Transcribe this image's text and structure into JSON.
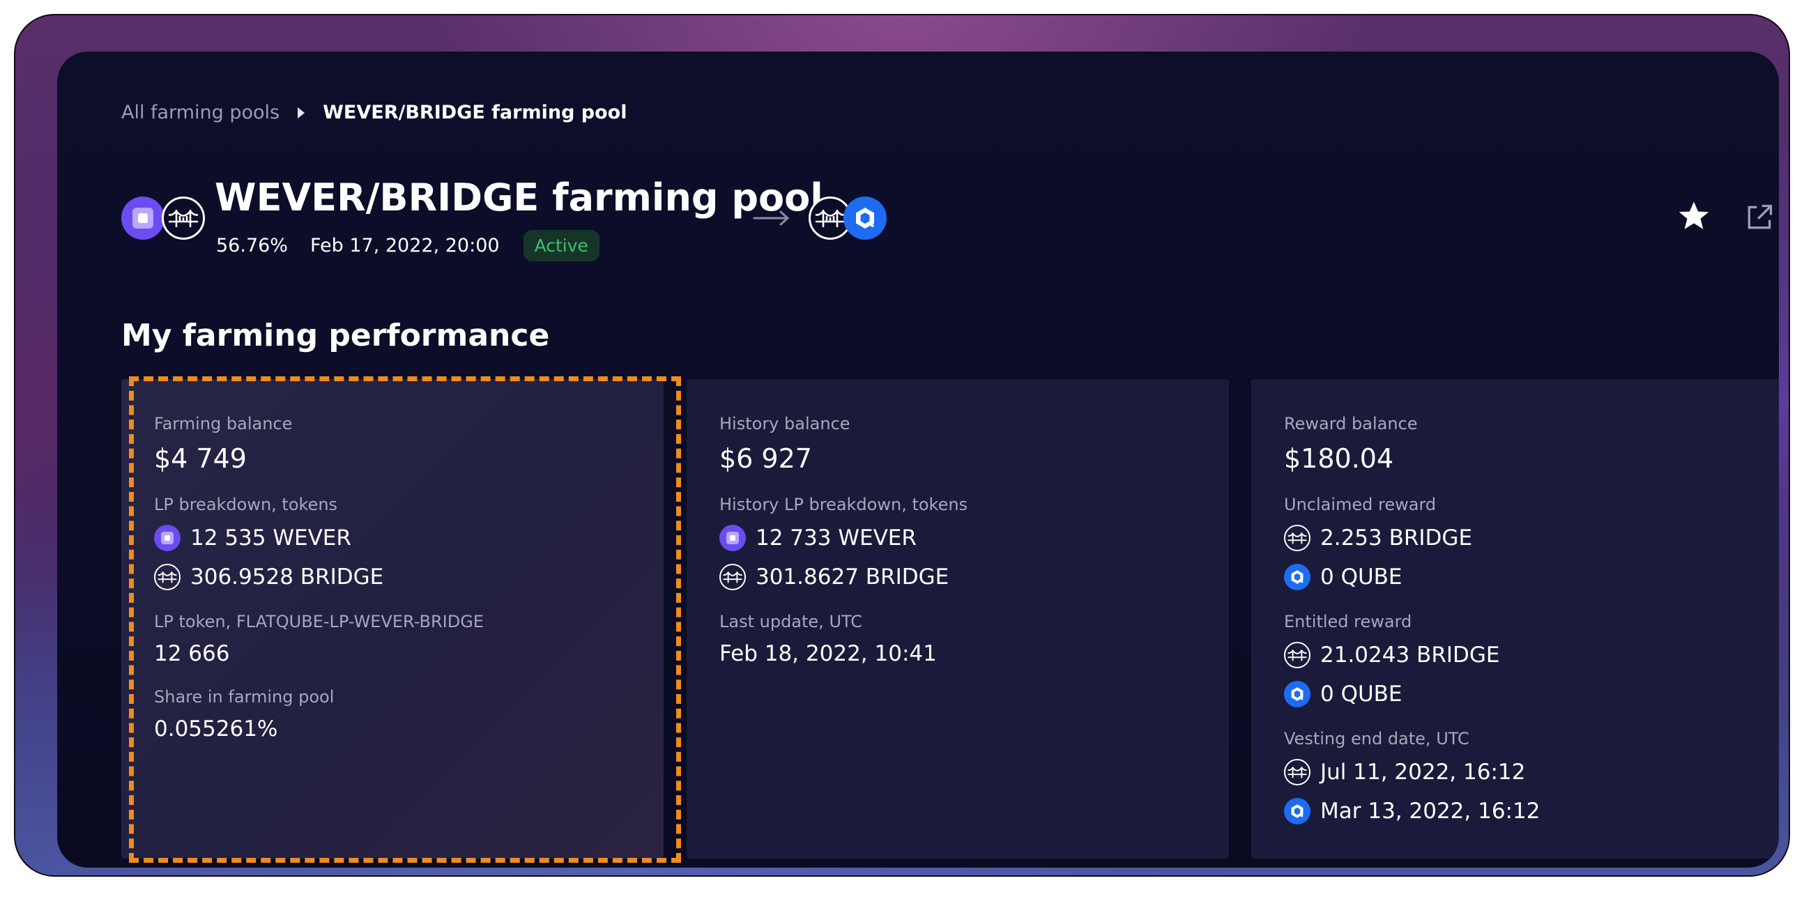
{
  "breadcrumb": {
    "parent": "All farming pools",
    "current": "WEVER/BRIDGE farming pool"
  },
  "pool": {
    "title": "WEVER/BRIDGE farming pool",
    "apr": "56.76%",
    "date": "Feb 17, 2022, 20:00",
    "status": "Active",
    "pair_icons": [
      "wever-token-icon",
      "bridge-token-icon"
    ],
    "reward_icons": [
      "bridge-token-icon",
      "qube-token-icon"
    ]
  },
  "section": {
    "title": "My farming performance"
  },
  "farming_card": {
    "balance_label": "Farming balance",
    "balance_value": "$4 749",
    "lp_breakdown_label": "LP breakdown, tokens",
    "lp_wever": "12 535 WEVER",
    "lp_bridge": "306.9528 BRIDGE",
    "lp_token_label": "LP token, FLATQUBE-LP-WEVER-BRIDGE",
    "lp_token_value": "12 666",
    "share_label": "Share in farming pool",
    "share_value": "0.055261%"
  },
  "history_card": {
    "balance_label": "History balance",
    "balance_value": "$6 927",
    "lp_breakdown_label": "History LP breakdown, tokens",
    "lp_wever": "12 733 WEVER",
    "lp_bridge": "301.8627 BRIDGE",
    "update_label": "Last update, UTC",
    "update_value": "Feb 18, 2022, 10:41"
  },
  "reward_card": {
    "balance_label": "Reward balance",
    "balance_value": "$180.04",
    "unclaimed_label": "Unclaimed reward",
    "unclaimed_bridge": "2.253 BRIDGE",
    "unclaimed_qube": "0 QUBE",
    "entitled_label": "Entitled reward",
    "entitled_bridge": "21.0243 BRIDGE",
    "entitled_qube": "0 QUBE",
    "vesting_label": "Vesting end date, UTC",
    "vesting_bridge": "Jul 11, 2022, 16:12",
    "vesting_qube": "Mar 13, 2022, 16:12"
  },
  "colors": {
    "highlight": "#f08c1c",
    "status_text": "#3fbf6a",
    "wever": "#6b4cf0",
    "qube": "#1d6cf2"
  }
}
